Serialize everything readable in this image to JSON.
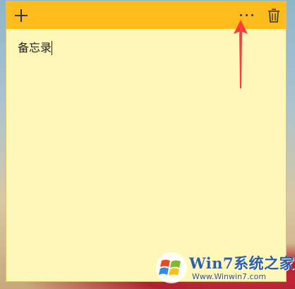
{
  "note": {
    "body_text": "备忘录",
    "colors": {
      "titlebar": "#fdbc1c",
      "body": "#fff7b8",
      "annotation_arrow": "#ff3b3b"
    },
    "toolbar": {
      "add_icon": "plus-icon",
      "more_icon": "ellipsis-icon",
      "delete_icon": "trash-icon"
    }
  },
  "watermark": {
    "title": "Win7系统之家",
    "url": "Www.Winwin7.com",
    "logo_icon": "windows-logo-icon"
  }
}
